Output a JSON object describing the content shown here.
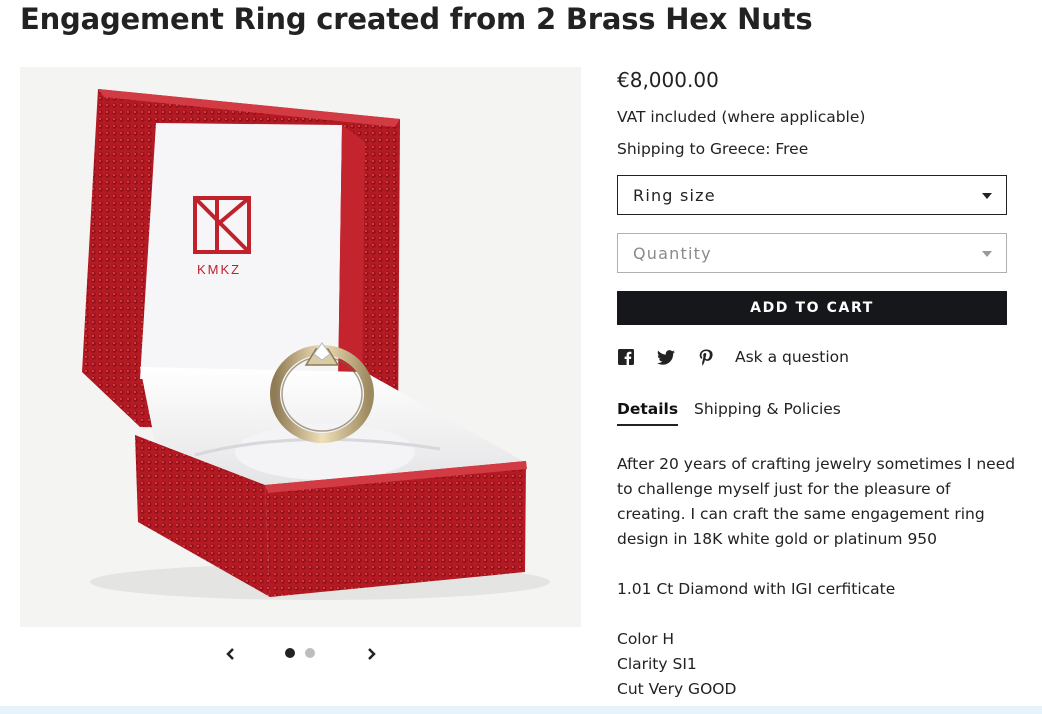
{
  "product": {
    "title": "Engagement Ring created from 2 Brass Hex Nuts",
    "price": "€8,000.00",
    "vat_note": "VAT included (where applicable)",
    "shipping_note": "Shipping to Greece: Free",
    "image_logo_text": "KMKZ"
  },
  "options": {
    "ring_size_label": "Ring size",
    "quantity_label": "Quantity"
  },
  "actions": {
    "add_to_cart": "ADD TO CART",
    "ask_question": "Ask a question"
  },
  "icons": {
    "facebook": "facebook-icon",
    "twitter": "twitter-icon",
    "pinterest": "pinterest-icon",
    "prev": "chevron-left-icon",
    "next": "chevron-right-icon"
  },
  "carousel": {
    "total_slides": 2,
    "active_slide": 1
  },
  "tabs": [
    {
      "label": "Details"
    },
    {
      "label": "Shipping & Policies"
    }
  ],
  "description": {
    "paragraph1": "After 20 years of crafting jewelry sometimes I need to challenge myself just for the pleasure of creating. I can craft the same engagement ring design in 18K white gold or platinum 950",
    "paragraph2": "1.01 Ct Diamond with IGI cerfiticate",
    "line_color": "Color H",
    "line_clarity": "Clarity SI1",
    "line_cut": "Cut Very GOOD"
  },
  "colors": {
    "button_bg": "#15171b",
    "box_red": "#b81a22",
    "gallery_bg": "#f4f4f3"
  }
}
